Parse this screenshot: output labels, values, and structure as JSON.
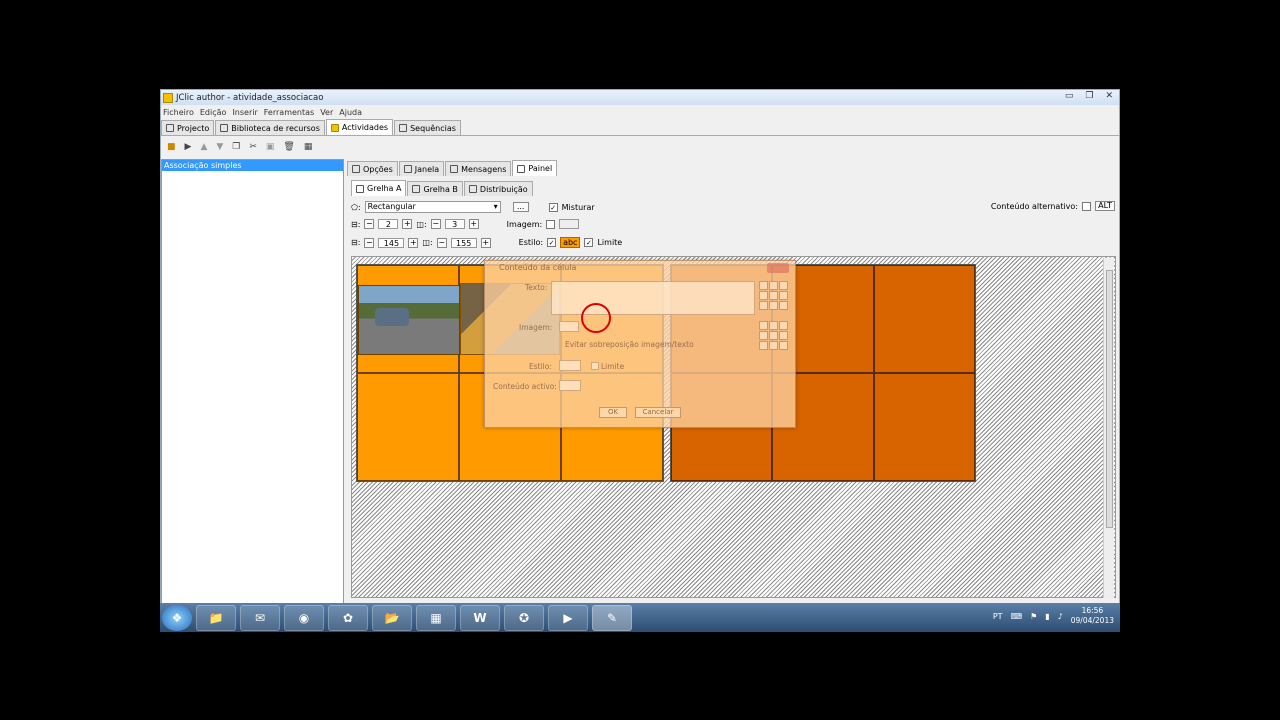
{
  "window": {
    "title": "JClic author - atividade_associacao",
    "controls": [
      "▭",
      "❐",
      "✕"
    ]
  },
  "menu": [
    "Ficheiro",
    "Edição",
    "Inserir",
    "Ferramentas",
    "Ver",
    "Ajuda"
  ],
  "tabs": [
    {
      "label": "Projecto"
    },
    {
      "label": "Biblioteca de recursos"
    },
    {
      "label": "Actividades"
    },
    {
      "label": "Sequências"
    }
  ],
  "toolbar_icons": [
    "folder-icon",
    "play-icon",
    "up-icon",
    "down-icon",
    "copy-icon",
    "cut-icon",
    "paste-icon",
    "delete-icon",
    "grid-icon"
  ],
  "activities": [
    "Associação simples"
  ],
  "subtabs": [
    {
      "label": "Opções"
    },
    {
      "label": "Janela"
    },
    {
      "label": "Mensagens"
    },
    {
      "label": "Painel"
    }
  ],
  "gridtabs": [
    {
      "label": "Grelha A"
    },
    {
      "label": "Grelha B"
    },
    {
      "label": "Distribuição"
    }
  ],
  "panel": {
    "shape": "Rectangular",
    "misturar": "Misturar",
    "rows": "2",
    "cols": "3",
    "width": "145",
    "height": "155",
    "imagem": "Imagem:",
    "estilo": "Estilo:",
    "estilo_sample": "abc",
    "limite": "Limite",
    "alt_label": "Conteúdo alternativo:",
    "alt_btn": "ALT",
    "more": "..."
  },
  "dialog": {
    "title": "Conteúdo da célula",
    "texto": "Texto:",
    "imagem": "Imagem:",
    "evitar": "Evitar sobreposição imagem/texto",
    "estilo": "Estilo:",
    "limite": "Limite",
    "conteudo": "Conteúdo activo:",
    "ok": "OK",
    "cancel": "Cancelar"
  },
  "taskbar": {
    "lang": "PT",
    "time": "16:56",
    "date": "09/04/2013"
  },
  "colors": {
    "gridA": "#ff9a00",
    "gridB": "#d86400",
    "selection": "#3399ff"
  }
}
